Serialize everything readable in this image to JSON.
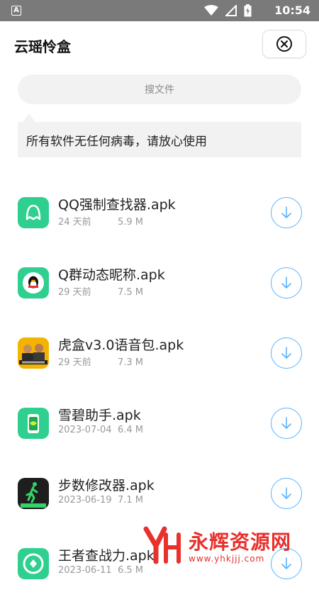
{
  "status_bar": {
    "left_icon": "A",
    "icons": [
      "wifi-icon",
      "signal-icon",
      "battery-icon"
    ],
    "time": "10:54"
  },
  "header": {
    "title": "云瑶怜盒",
    "close_icon": "close-icon"
  },
  "search": {
    "placeholder": "搜文件"
  },
  "notice": {
    "text": "所有软件无任何病毒，请放心使用"
  },
  "files": [
    {
      "name": "QQ强制查找器.apk",
      "date": "24 天前",
      "size": "5.9 M",
      "icon": "qq-ghost-icon",
      "icon_color": "#2ecf8f"
    },
    {
      "name": "Q群动态昵称.apk",
      "date": "29 天前",
      "size": "7.5 M",
      "icon": "qq-penguin-icon",
      "icon_color": "#2ecf8f"
    },
    {
      "name": "虎盒v3.0语音包.apk",
      "date": "29 天前",
      "size": "7.3 M",
      "icon": "huhe-photo-icon",
      "icon_color": "#f2b400"
    },
    {
      "name": "雪碧助手.apk",
      "date": "2023-07-04",
      "size": "6.4 M",
      "icon": "sprite-can-icon",
      "icon_color": "#2ecf8f"
    },
    {
      "name": "步数修改器.apk",
      "date": "2023-06-19",
      "size": "7.1 M",
      "icon": "walking-man-icon",
      "icon_color": "#1e1e1e"
    },
    {
      "name": "王者查战力.apk",
      "date": "2023-06-11",
      "size": "6.5 M",
      "icon": "king-icon",
      "icon_color": "#2ecf8f"
    }
  ],
  "watermark": {
    "cn": "永辉资源网",
    "url": "www.yhkjjj.com"
  },
  "colors": {
    "accent": "#5ab3ff",
    "watermark": "#e8302c",
    "app_green": "#2ecf8f"
  }
}
